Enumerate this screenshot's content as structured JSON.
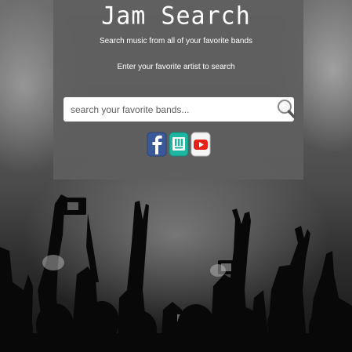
{
  "header": {
    "title": "Jam Search",
    "subtitle": "Search music from all of your favorite bands",
    "prompt": "Enter your favorite artist to search"
  },
  "search": {
    "placeholder": "search your favorite bands...",
    "value": ""
  },
  "social_links": [
    {
      "icon": "facebook-icon",
      "color": "#3b5998"
    },
    {
      "icon": "bandsintown-icon",
      "color": "#1fb6a1"
    },
    {
      "icon": "youtube-icon",
      "color": "#e62117"
    }
  ],
  "colors": {
    "panel": "#5f5f5f",
    "text": "#ffffff"
  }
}
